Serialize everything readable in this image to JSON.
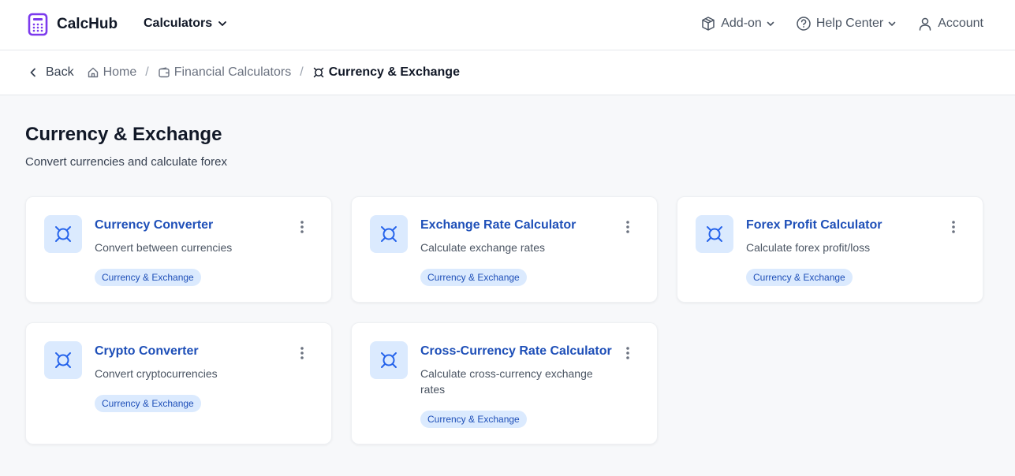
{
  "brand": {
    "name": "CalcHub",
    "accent": "#7c3aed"
  },
  "nav": {
    "calculators_label": "Calculators",
    "addon_label": "Add-on",
    "help_label": "Help Center",
    "account_label": "Account"
  },
  "breadcrumb": {
    "back": "Back",
    "home": "Home",
    "financial": "Financial Calculators",
    "current": "Currency & Exchange"
  },
  "page": {
    "title": "Currency & Exchange",
    "subtitle": "Convert currencies and calculate forex"
  },
  "cards": [
    {
      "title": "Currency Converter",
      "description": "Convert between currencies",
      "tag": "Currency & Exchange",
      "icon": "currency-icon"
    },
    {
      "title": "Exchange Rate Calculator",
      "description": "Calculate exchange rates",
      "tag": "Currency & Exchange",
      "icon": "currency-icon"
    },
    {
      "title": "Forex Profit Calculator",
      "description": "Calculate forex profit/loss",
      "tag": "Currency & Exchange",
      "icon": "currency-icon"
    },
    {
      "title": "Crypto Converter",
      "description": "Convert cryptocurrencies",
      "tag": "Currency & Exchange",
      "icon": "currency-icon"
    },
    {
      "title": "Cross-Currency Rate Calculator",
      "description": "Calculate cross-currency exchange rates",
      "tag": "Currency & Exchange",
      "icon": "currency-icon"
    }
  ],
  "colors": {
    "link": "#1e4fb8",
    "tag_bg": "#dbeafe",
    "icon_bg": "#dbeafe"
  }
}
